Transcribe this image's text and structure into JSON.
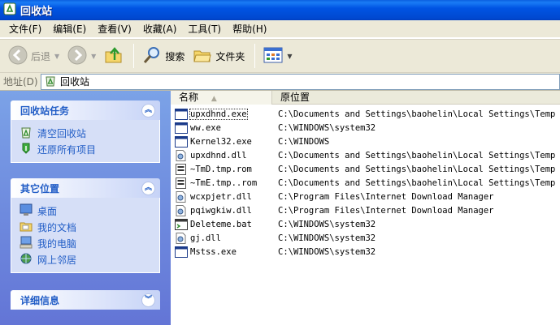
{
  "window": {
    "title": "回收站"
  },
  "menu": [
    {
      "label": "文件(F)"
    },
    {
      "label": "编辑(E)"
    },
    {
      "label": "查看(V)"
    },
    {
      "label": "收藏(A)"
    },
    {
      "label": "工具(T)"
    },
    {
      "label": "帮助(H)"
    }
  ],
  "toolbar": {
    "back_label": "后退",
    "search_label": "搜索",
    "folders_label": "文件夹"
  },
  "address": {
    "label": "地址(D)",
    "value": "回收站"
  },
  "tasks_panel": {
    "title": "回收站任务",
    "items": [
      {
        "label": "清空回收站",
        "icon": "empty-recycle-bin-icon"
      },
      {
        "label": "还原所有项目",
        "icon": "restore-all-icon"
      }
    ]
  },
  "places_panel": {
    "title": "其它位置",
    "items": [
      {
        "label": "桌面",
        "icon": "desktop-icon"
      },
      {
        "label": "我的文档",
        "icon": "my-documents-icon"
      },
      {
        "label": "我的电脑",
        "icon": "my-computer-icon"
      },
      {
        "label": "网上邻居",
        "icon": "network-places-icon"
      }
    ]
  },
  "details_panel": {
    "title": "详细信息"
  },
  "columns": {
    "name": "名称",
    "location": "原位置"
  },
  "files": [
    {
      "name": "upxdhnd.exe",
      "location": "C:\\Documents and Settings\\baohelin\\Local Settings\\Temp",
      "icon": "exe-window-icon"
    },
    {
      "name": "ww.exe",
      "location": "C:\\WINDOWS\\system32",
      "icon": "exe-window-icon"
    },
    {
      "name": "Kernel32.exe",
      "location": "C:\\WINDOWS",
      "icon": "exe-window-icon"
    },
    {
      "name": "upxdhnd.dll",
      "location": "C:\\Documents and Settings\\baohelin\\Local Settings\\Temp",
      "icon": "dll-file-icon"
    },
    {
      "name": "~TmD.tmp.rom",
      "location": "C:\\Documents and Settings\\baohelin\\Local Settings\\Temp",
      "icon": "rom-file-icon"
    },
    {
      "name": "~TmE.tmp..rom",
      "location": "C:\\Documents and Settings\\baohelin\\Local Settings\\Temp",
      "icon": "rom-file-icon"
    },
    {
      "name": "wcxpjetr.dll",
      "location": "C:\\Program Files\\Internet Download Manager",
      "icon": "dll-file-icon"
    },
    {
      "name": "pqiwgkiw.dll",
      "location": "C:\\Program Files\\Internet Download Manager",
      "icon": "dll-file-icon"
    },
    {
      "name": "Deleteme.bat",
      "location": "C:\\WINDOWS\\system32",
      "icon": "batch-file-icon"
    },
    {
      "name": "gj.dll",
      "location": "C:\\WINDOWS\\system32",
      "icon": "dll-file-icon"
    },
    {
      "name": "Mstss.exe",
      "location": "C:\\WINDOWS\\system32",
      "icon": "exe-window-icon"
    }
  ]
}
